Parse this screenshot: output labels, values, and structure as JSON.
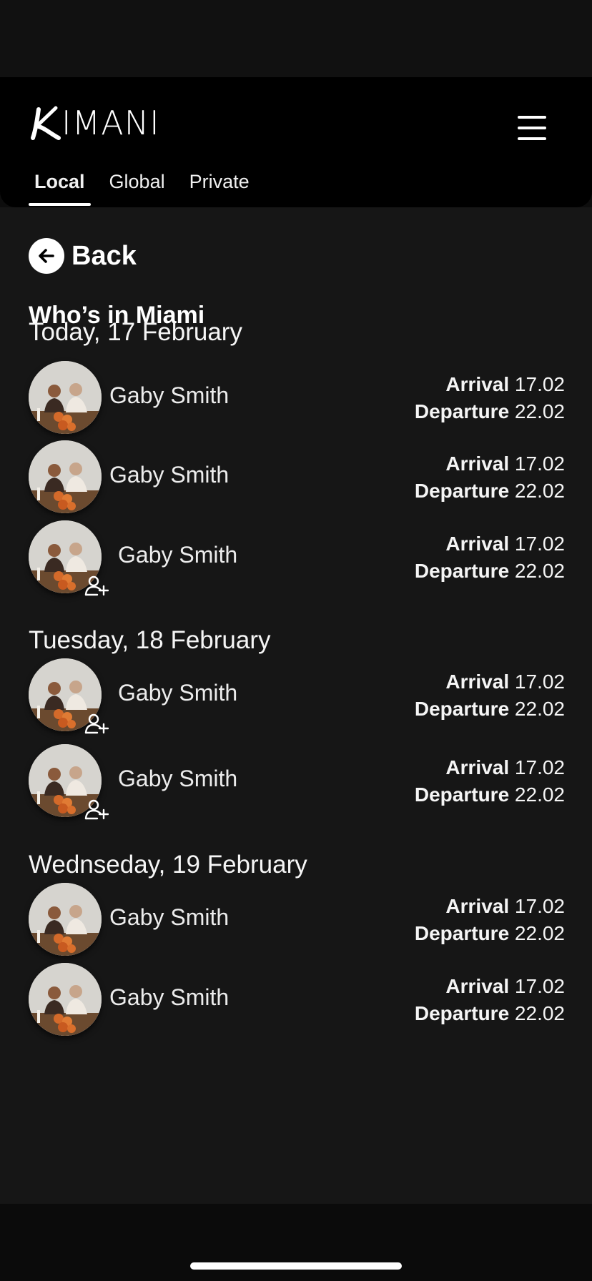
{
  "header": {
    "logo_text": "IMANI",
    "tabs": [
      {
        "label": "Local",
        "active": true
      },
      {
        "label": "Global",
        "active": false
      },
      {
        "label": "Private",
        "active": false
      }
    ]
  },
  "back_label": "Back",
  "page_title": "Who’s in Miami",
  "arrival_label": "Arrival",
  "departure_label": "Departure",
  "groups": [
    {
      "day": "Today, 17 February",
      "people": [
        {
          "name": "Gaby Smith",
          "arrival": "17.02",
          "departure": "22.02",
          "can_add": false
        },
        {
          "name": "Gaby Smith",
          "arrival": "17.02",
          "departure": "22.02",
          "can_add": false
        },
        {
          "name": "Gaby Smith",
          "arrival": "17.02",
          "departure": "22.02",
          "can_add": true
        }
      ]
    },
    {
      "day": "Tuesday, 18 February",
      "people": [
        {
          "name": "Gaby Smith",
          "arrival": "17.02",
          "departure": "22.02",
          "can_add": true
        },
        {
          "name": "Gaby Smith",
          "arrival": "17.02",
          "departure": "22.02",
          "can_add": true
        }
      ]
    },
    {
      "day": "Wednseday, 19 February",
      "people": [
        {
          "name": "Gaby Smith",
          "arrival": "17.02",
          "departure": "22.02",
          "can_add": false
        },
        {
          "name": "Gaby Smith",
          "arrival": "17.02",
          "departure": "22.02",
          "can_add": false
        }
      ]
    }
  ],
  "icons": {
    "menu": "hamburger-menu-icon",
    "back": "arrow-left-icon",
    "add_friend": "user-plus-icon"
  },
  "colors": {
    "background": "#161616",
    "header": "#000000",
    "text": "#ffffff"
  }
}
